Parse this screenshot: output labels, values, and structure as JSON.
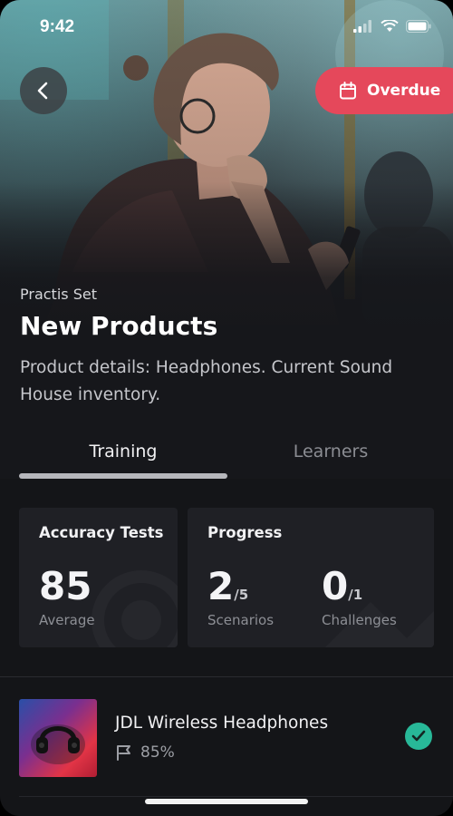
{
  "status_bar": {
    "time": "9:42"
  },
  "header": {
    "back_icon": "chevron-left-icon",
    "overdue": {
      "icon": "calendar-icon",
      "label": "Overdue",
      "color": "#e5485b"
    }
  },
  "practis_set": {
    "kicker": "Practis Set",
    "title": "New Products",
    "description": "Product details:  Headphones. Current Sound House inventory."
  },
  "tabs": [
    {
      "label": "Training",
      "active": true
    },
    {
      "label": "Learners",
      "active": false
    }
  ],
  "stats": {
    "accuracy": {
      "title": "Accuracy Tests",
      "value": "85",
      "label": "Average"
    },
    "progress": {
      "title": "Progress",
      "scenarios": {
        "value": "2",
        "total": "/5",
        "label": "Scenarios"
      },
      "challenges": {
        "value": "0",
        "total": "/1",
        "label": "Challenges"
      }
    }
  },
  "list": {
    "items": [
      {
        "title": "JDL Wireless Headphones",
        "score": "85%",
        "score_icon": "flag-icon",
        "status_icon": "check-circle-icon",
        "status_color": "#28b898"
      }
    ]
  }
}
